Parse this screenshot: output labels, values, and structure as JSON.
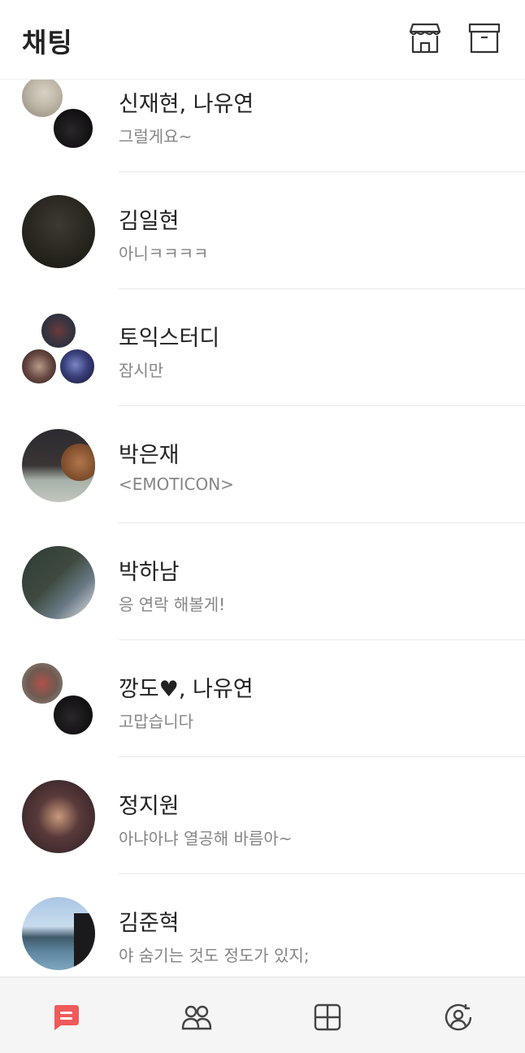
{
  "header": {
    "title": "채팅",
    "store_icon": "store-icon",
    "archive_icon": "archive-icon"
  },
  "chats": [
    {
      "name": "신재현, 나유연",
      "message": "그럴게요~",
      "avatar_type": "pair"
    },
    {
      "name": "김일현",
      "message": "아니ㅋㅋㅋㅋ",
      "avatar_type": "single"
    },
    {
      "name": "토익스터디",
      "message": "잠시만",
      "avatar_type": "group"
    },
    {
      "name": "박은재",
      "message": "<EMOTICON>",
      "avatar_type": "single"
    },
    {
      "name": "박하남",
      "message": "응 연락 해볼게!",
      "avatar_type": "single"
    },
    {
      "name": "깡도♥, 나유연",
      "message": "고맙습니다",
      "avatar_type": "pair"
    },
    {
      "name": "정지원",
      "message": "아냐아냐 열공해 바름아~",
      "avatar_type": "single"
    },
    {
      "name": "김준혁",
      "message": "야 숨기는 것도 정도가 있지;",
      "avatar_type": "single"
    }
  ],
  "bottom_nav": [
    {
      "name": "chats",
      "icon": "chat-bubble-icon",
      "active": true
    },
    {
      "name": "friends",
      "icon": "people-icon",
      "active": false
    },
    {
      "name": "more",
      "icon": "grid-icon",
      "active": false
    },
    {
      "name": "profile",
      "icon": "user-circle-icon",
      "active": false
    }
  ],
  "colors": {
    "accent": "#ef5b5b",
    "nav_icon": "#444444",
    "message_text": "#858585",
    "divider": "#e8e8e8"
  }
}
